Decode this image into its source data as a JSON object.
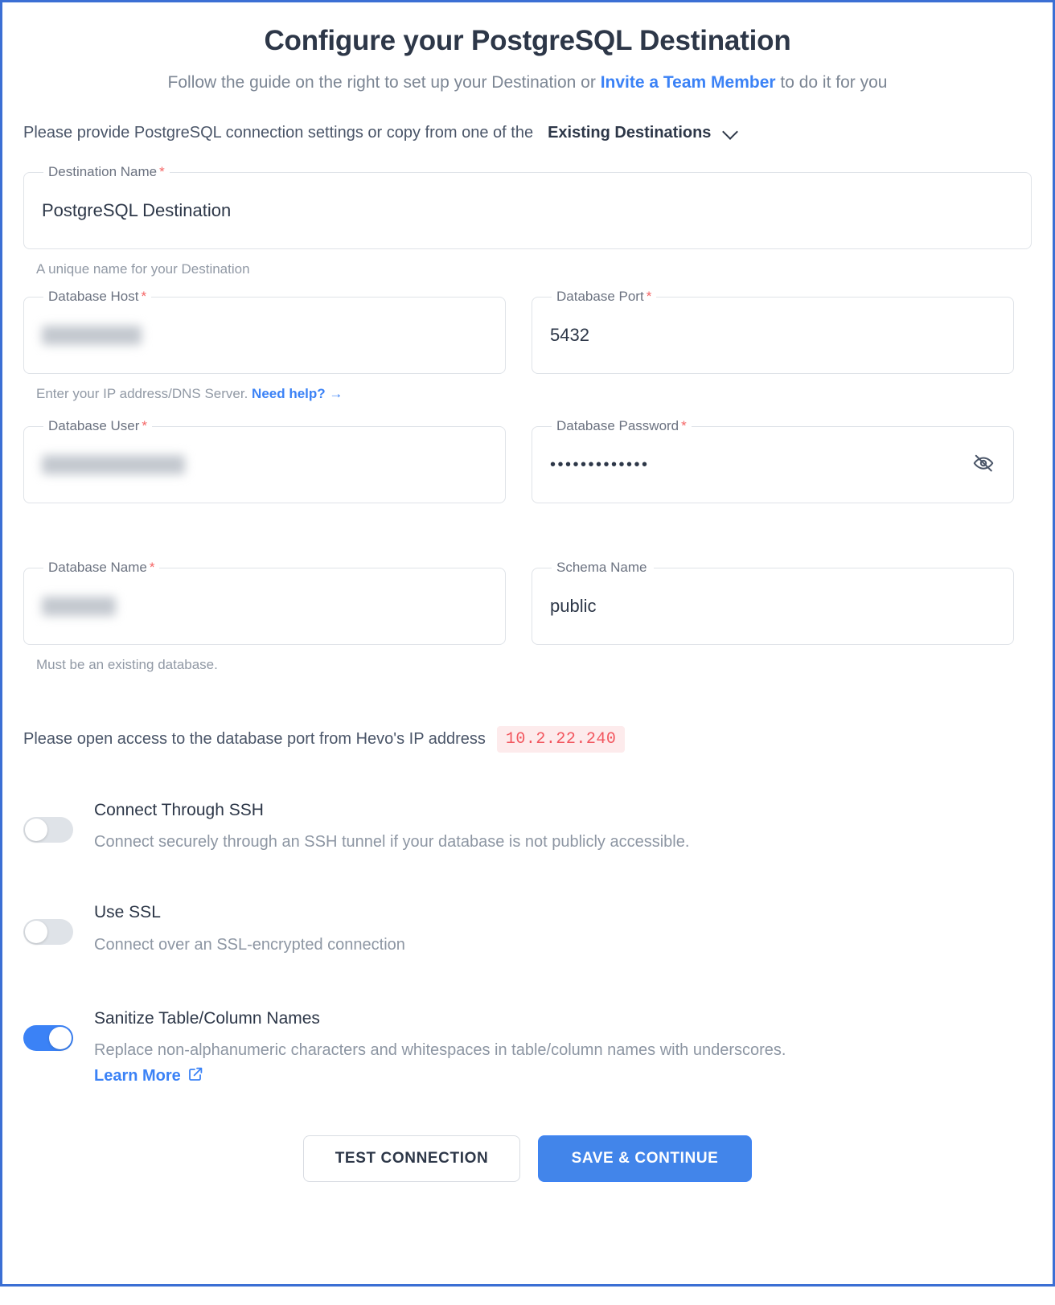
{
  "header": {
    "title": "Configure your PostgreSQL Destination",
    "subtitle_before": "Follow the guide on the right to set up your Destination or",
    "subtitle_link": "Invite a Team Member",
    "subtitle_after": "to do it for you"
  },
  "copy_row": {
    "text": "Please provide PostgreSQL connection settings or copy from one of the",
    "dropdown_label": "Existing Destinations",
    "dropdown_icon": "chevron-down-icon"
  },
  "fields": {
    "destination_name": {
      "label": "Destination Name",
      "required": "*",
      "value": "PostgreSQL Destination",
      "hint": "A unique name for your Destination"
    },
    "database_host": {
      "label": "Database Host",
      "required": "*",
      "value": "10.0.16.130",
      "redacted": true,
      "hint_before": "Enter your IP address/DNS Server.",
      "hint_link": "Need help?",
      "hint_arrow": "→"
    },
    "database_port": {
      "label": "Database Port",
      "required": "*",
      "value": "5432"
    },
    "database_user": {
      "label": "Database User",
      "required": "*",
      "value": "hevo_user_name",
      "redacted": true
    },
    "database_password": {
      "label": "Database Password",
      "required": "*",
      "value": "•••••••••••••",
      "toggle_icon": "eye-off-icon"
    },
    "database_name": {
      "label": "Database Name",
      "required": "*",
      "value": "postgres",
      "redacted": true,
      "hint": "Must be an existing database."
    },
    "schema_name": {
      "label": "Schema Name",
      "required": "",
      "value": "public"
    }
  },
  "ip_note": {
    "text": "Please open access to the database port from Hevo's IP address",
    "ip": "10.2.22.240"
  },
  "toggles": [
    {
      "name": "connect-through-ssh",
      "title": "Connect Through SSH",
      "description": "Connect securely through an SSH tunnel if your database is not publicly accessible.",
      "state": "off"
    },
    {
      "name": "use-ssl",
      "title": "Use SSL",
      "description": "Connect over an SSL-encrypted connection",
      "state": "off"
    },
    {
      "name": "sanitize-table-column-names",
      "title": "Sanitize Table/Column Names",
      "description": "Replace non-alphanumeric characters and whitespaces in table/column names with underscores.",
      "link": "Learn More",
      "link_icon": "external-link-icon",
      "state": "on"
    }
  ],
  "buttons": {
    "test": "TEST CONNECTION",
    "save": "SAVE & CONTINUE"
  },
  "colors": {
    "accent": "#3b82f6",
    "frame": "#3b6fd4",
    "required": "#f56565",
    "ip_text": "#f2575f",
    "ip_bg": "#fdebec"
  }
}
